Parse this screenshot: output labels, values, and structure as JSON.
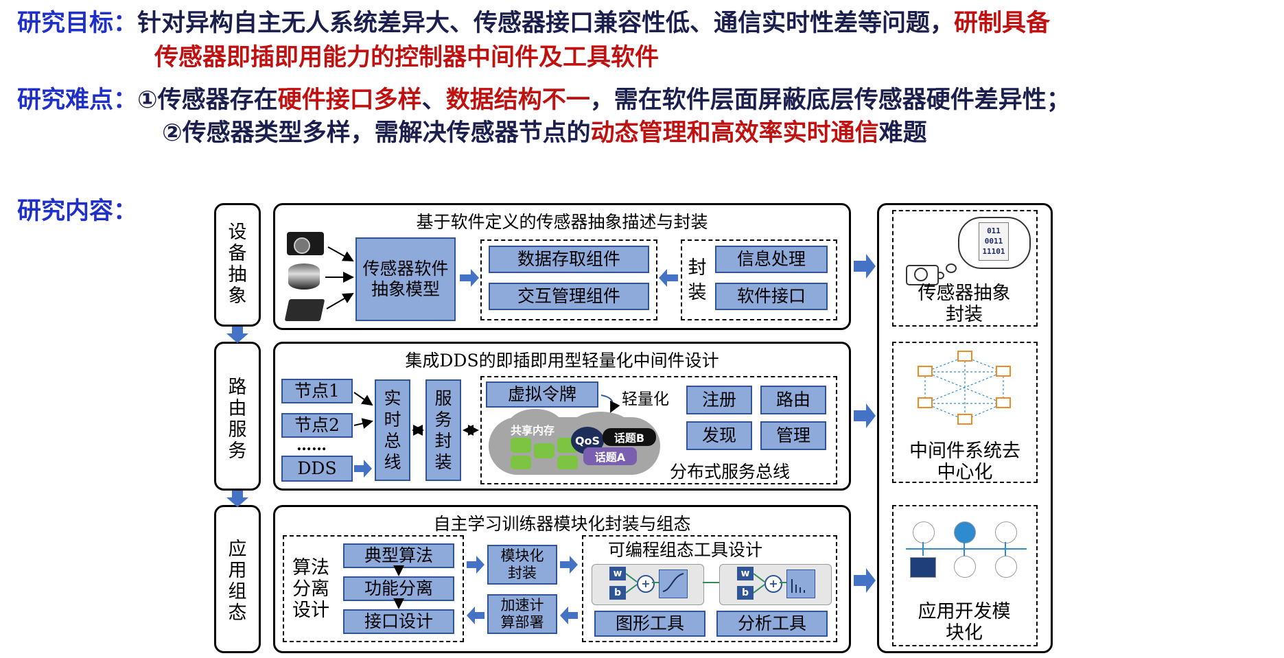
{
  "heading": {
    "goal_label": "研究目标：",
    "goal_text": "针对异构自主无人系统差异大、传感器接口兼容性低、通信实时性差等问题，",
    "goal_red_1": "研制具备",
    "goal_red_2": "传感器即插即用能力的控制器中间件及工具软件",
    "difficulty_label": "研究难点：",
    "d1_prefix": "①传感器存在",
    "d1_red_a": "硬件接口多样",
    "d1_sep": "、",
    "d1_red_b": "数据结构不一",
    "d1_suffix": "，需在软件层面屏蔽底层传感器硬件差异性；",
    "d2_prefix": "②传感器类型多样，需解决传感器节点的",
    "d2_red": "动态管理和高效率实时通信",
    "d2_suffix": "难题",
    "content_label": "研究内容："
  },
  "left_column": [
    "设备抽象",
    "路由服务",
    "应用组态"
  ],
  "panel1": {
    "title": "基于软件定义的传感器抽象描述与封装",
    "model": "传感器软件抽象模型",
    "components": [
      "数据存取组件",
      "交互管理组件"
    ],
    "pack_label": "封装",
    "pack_items": [
      "信息处理",
      "软件接口"
    ]
  },
  "panel2": {
    "title": "集成DDS的即插即用型轻量化中间件设计",
    "nodes": [
      "节点1",
      "节点2",
      "……",
      "DDS"
    ],
    "rt_bus": "实时总线",
    "svc_pack": "服务封装",
    "virtual_token": "虚拟令牌",
    "lightweight": "轻量化",
    "shared_mem": "共享内存",
    "qos": "QoS",
    "topic_b": "话题B",
    "topic_a": "话题A",
    "services": [
      "注册",
      "路由",
      "发现",
      "管理"
    ],
    "dist_bus": "分布式服务总线"
  },
  "panel3": {
    "title": "自主学习训练器模块化封装与组态",
    "algo_sep": "算法分离设计",
    "algo_items": [
      "典型算法",
      "功能分离",
      "接口设计"
    ],
    "modular_pack": "模块化封装",
    "accel_deploy": "加速计算部署",
    "prog_tool": "可编程组态工具设计",
    "tools": [
      "图形工具",
      "分析工具"
    ],
    "nn_w": "w",
    "nn_b": "b"
  },
  "right_column": {
    "features": [
      "传感器抽象封装",
      "中间件系统去中心化",
      "应用开发模块化"
    ],
    "binary": [
      "011",
      "0011",
      "11101"
    ]
  },
  "colors": {
    "label_blue": "#1f30c8",
    "text_navy": "#1b1f4e",
    "accent_red": "#c01010",
    "box_fill": "#8eaadb",
    "box_border": "#2f5597",
    "arrow_blue": "#4472c4"
  }
}
